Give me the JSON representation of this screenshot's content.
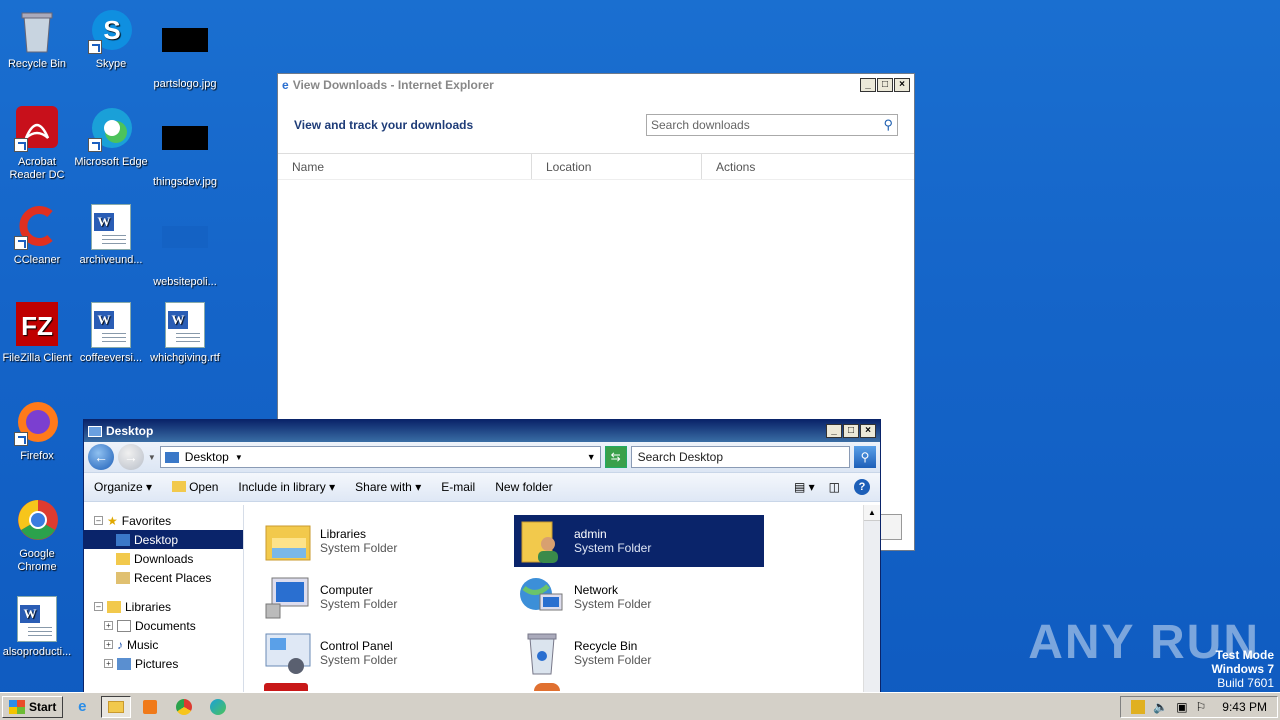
{
  "desktop": {
    "icons": [
      {
        "label": "Recycle Bin"
      },
      {
        "label": "Skype"
      },
      {
        "label": "partslogo.jpg"
      },
      {
        "label": "Acrobat Reader DC"
      },
      {
        "label": "Microsoft Edge"
      },
      {
        "label": "thingsdev.jpg"
      },
      {
        "label": "CCleaner"
      },
      {
        "label": "archiveund..."
      },
      {
        "label": "websitepoli..."
      },
      {
        "label": "FileZilla Client"
      },
      {
        "label": "coffeeversi..."
      },
      {
        "label": "whichgiving.rtf"
      },
      {
        "label": "Firefox"
      },
      {
        "label": "Google Chrome"
      },
      {
        "label": "alsoproducti..."
      }
    ]
  },
  "ie_window": {
    "title": "View Downloads - Internet Explorer",
    "heading": "View and track your downloads",
    "search_placeholder": "Search downloads",
    "columns": [
      "Name",
      "Location",
      "Actions"
    ]
  },
  "explorer": {
    "title": "Desktop",
    "address": "Desktop",
    "search_value": "Search Desktop",
    "toolbar": {
      "organize": "Organize",
      "open": "Open",
      "include": "Include in library",
      "share": "Share with",
      "email": "E-mail",
      "new_folder": "New folder"
    },
    "nav": {
      "favorites": "Favorites",
      "desktop": "Desktop",
      "downloads": "Downloads",
      "recent": "Recent Places",
      "libraries": "Libraries",
      "documents": "Documents",
      "music": "Music",
      "pictures": "Pictures"
    },
    "items": [
      {
        "name": "Libraries",
        "type": "System Folder"
      },
      {
        "name": "admin",
        "type": "System Folder"
      },
      {
        "name": "Computer",
        "type": "System Folder"
      },
      {
        "name": "Network",
        "type": "System Folder"
      },
      {
        "name": "Control Panel",
        "type": "System Folder"
      },
      {
        "name": "Recycle Bin",
        "type": "System Folder"
      }
    ]
  },
  "taskbar": {
    "start": "Start",
    "clock": "9:43 PM"
  },
  "watermark": {
    "text": "ANY RUN",
    "mode": "Test Mode",
    "os": "Windows 7",
    "build": "Build 7601"
  },
  "colors": {
    "desktop_bg": "#1565c9",
    "selection": "#0a246a"
  }
}
